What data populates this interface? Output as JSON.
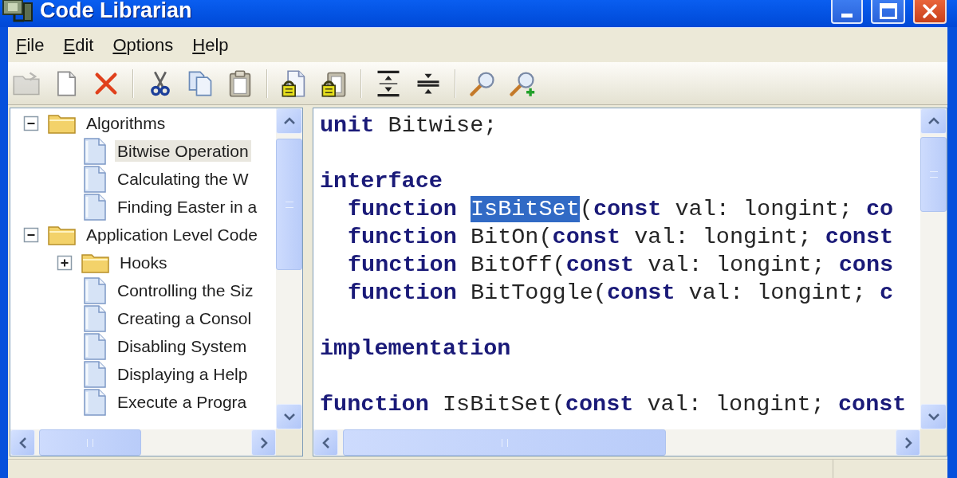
{
  "window": {
    "title": "Code Librarian"
  },
  "menu": [
    "File",
    "Edit",
    "Options",
    "Help"
  ],
  "toolbar": {
    "groups": [
      [
        {
          "kind": "folder",
          "disabled": true
        },
        {
          "kind": "page",
          "disabled": false
        },
        {
          "kind": "cross",
          "disabled": false
        }
      ],
      [
        {
          "kind": "scissors",
          "disabled": false
        },
        {
          "kind": "copy",
          "disabled": false
        },
        {
          "kind": "clipboard",
          "disabled": false
        }
      ],
      [
        {
          "kind": "lockpage",
          "disabled": false
        },
        {
          "kind": "lockclip",
          "disabled": false
        }
      ],
      [
        {
          "kind": "spread",
          "disabled": false
        },
        {
          "kind": "squeeze",
          "disabled": false
        }
      ],
      [
        {
          "kind": "magnifier",
          "disabled": false
        },
        {
          "kind": "magnifierplus",
          "disabled": false
        }
      ]
    ]
  },
  "tree": {
    "items": [
      {
        "kind": "folder",
        "label": "Algorithms",
        "expanded": true,
        "selected": false,
        "children": [
          {
            "kind": "document",
            "label": "Bitwise Operation",
            "selected": true
          },
          {
            "kind": "document",
            "label": "Calculating the W",
            "selected": false
          },
          {
            "kind": "document",
            "label": "Finding Easter in a",
            "selected": false
          }
        ]
      },
      {
        "kind": "folder",
        "label": "Application Level Code",
        "expanded": true,
        "selected": false,
        "children": [
          {
            "kind": "folder",
            "label": "Hooks",
            "expanded": false,
            "selected": false
          },
          {
            "kind": "document",
            "label": "Controlling the Siz",
            "selected": false
          },
          {
            "kind": "document",
            "label": "Creating a Consol",
            "selected": false
          },
          {
            "kind": "document",
            "label": "Disabling System",
            "selected": false
          },
          {
            "kind": "document",
            "label": "Displaying a Help",
            "selected": false
          },
          {
            "kind": "document",
            "label": "Execute a Progra",
            "selected": false
          }
        ]
      }
    ]
  },
  "code": {
    "blocks": [
      [
        {
          "tokens": [
            {
              "text": "unit",
              "kind": "keyword",
              "selected": false
            },
            {
              "text": " Bitwise;",
              "kind": "plain",
              "selected": false
            }
          ]
        }
      ],
      [
        {
          "tokens": [
            {
              "text": "interface",
              "kind": "keyword",
              "selected": false
            }
          ],
          "children": [
            {
              "tokens": [
                {
                  "text": "function ",
                  "kind": "keyword",
                  "selected": false
                },
                {
                  "text": "IsBitSet",
                  "kind": "plain",
                  "selected": true
                },
                {
                  "text": "(",
                  "kind": "plain",
                  "selected": false
                },
                {
                  "text": "const",
                  "kind": "keyword",
                  "selected": false
                },
                {
                  "text": " val: longint; ",
                  "kind": "plain",
                  "selected": false
                },
                {
                  "text": "co",
                  "kind": "keyword",
                  "selected": false
                }
              ]
            },
            {
              "tokens": [
                {
                  "text": "function",
                  "kind": "keyword",
                  "selected": false
                },
                {
                  "text": " BitOn(",
                  "kind": "plain",
                  "selected": false
                },
                {
                  "text": "const",
                  "kind": "keyword",
                  "selected": false
                },
                {
                  "text": " val: longint; ",
                  "kind": "plain",
                  "selected": false
                },
                {
                  "text": "const",
                  "kind": "keyword",
                  "selected": false
                }
              ]
            },
            {
              "tokens": [
                {
                  "text": "function",
                  "kind": "keyword",
                  "selected": false
                },
                {
                  "text": " BitOff(",
                  "kind": "plain",
                  "selected": false
                },
                {
                  "text": "const",
                  "kind": "keyword",
                  "selected": false
                },
                {
                  "text": " val: longint; ",
                  "kind": "plain",
                  "selected": false
                },
                {
                  "text": "cons",
                  "kind": "keyword",
                  "selected": false
                }
              ]
            },
            {
              "tokens": [
                {
                  "text": "function",
                  "kind": "keyword",
                  "selected": false
                },
                {
                  "text": " BitToggle(",
                  "kind": "plain",
                  "selected": false
                },
                {
                  "text": "const",
                  "kind": "keyword",
                  "selected": false
                },
                {
                  "text": " val: longint; ",
                  "kind": "plain",
                  "selected": false
                },
                {
                  "text": "c",
                  "kind": "keyword",
                  "selected": false
                }
              ]
            }
          ]
        }
      ],
      [
        {
          "tokens": [
            {
              "text": "implementation",
              "kind": "keyword",
              "selected": false
            }
          ]
        }
      ],
      [
        {
          "tokens": [
            {
              "text": "function",
              "kind": "keyword",
              "selected": false
            },
            {
              "text": " IsBitSet(",
              "kind": "plain",
              "selected": false
            },
            {
              "text": "const",
              "kind": "keyword",
              "selected": false
            },
            {
              "text": " val: longint; ",
              "kind": "plain",
              "selected": false
            },
            {
              "text": "const",
              "kind": "keyword",
              "selected": false
            }
          ]
        }
      ]
    ]
  }
}
